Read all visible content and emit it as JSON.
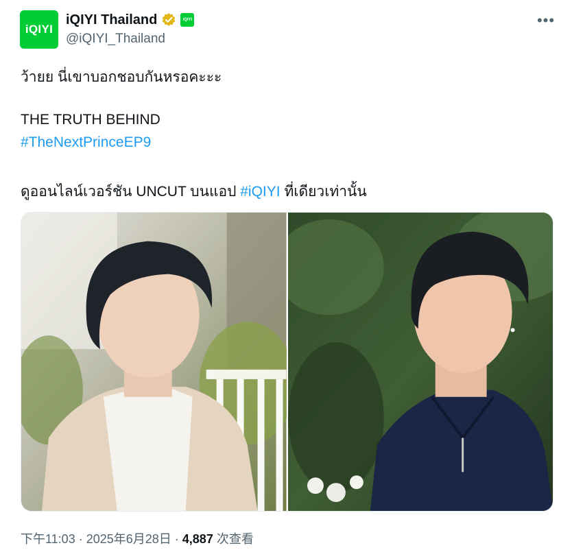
{
  "account": {
    "avatar_text": "iQIYI",
    "display_name": "iQIYI Thailand",
    "handle": "@iQIYI_Thailand",
    "affiliate_badge_text": "iQIYI"
  },
  "menu": {
    "more_label": "•••"
  },
  "tweet": {
    "line1": "ว้ายย นี่เขาบอกชอบกันหรอคะะะ",
    "line2": "THE TRUTH BEHIND",
    "hashtag1": "#TheNextPrinceEP9",
    "line3_pre": "ดูออนไลน์เวอร์ชัน UNCUT บนแอป ",
    "hashtag2": "#iQIYI",
    "line3_post": " ที่เดียวเท่านั้น"
  },
  "media": {
    "images": [
      {
        "icon": "photo-left-young-man-beige-shirt"
      },
      {
        "icon": "photo-right-young-man-navy-polo"
      }
    ]
  },
  "footer": {
    "timestamp": "下午11:03 · 2025年6月28日 · ",
    "views_count": "4,887",
    "views_label": " 次查看"
  },
  "colors": {
    "brand_green": "#00cc36",
    "link_blue": "#1d9bf0",
    "muted_gray": "#536471",
    "verified_gold": "#e2b719"
  }
}
